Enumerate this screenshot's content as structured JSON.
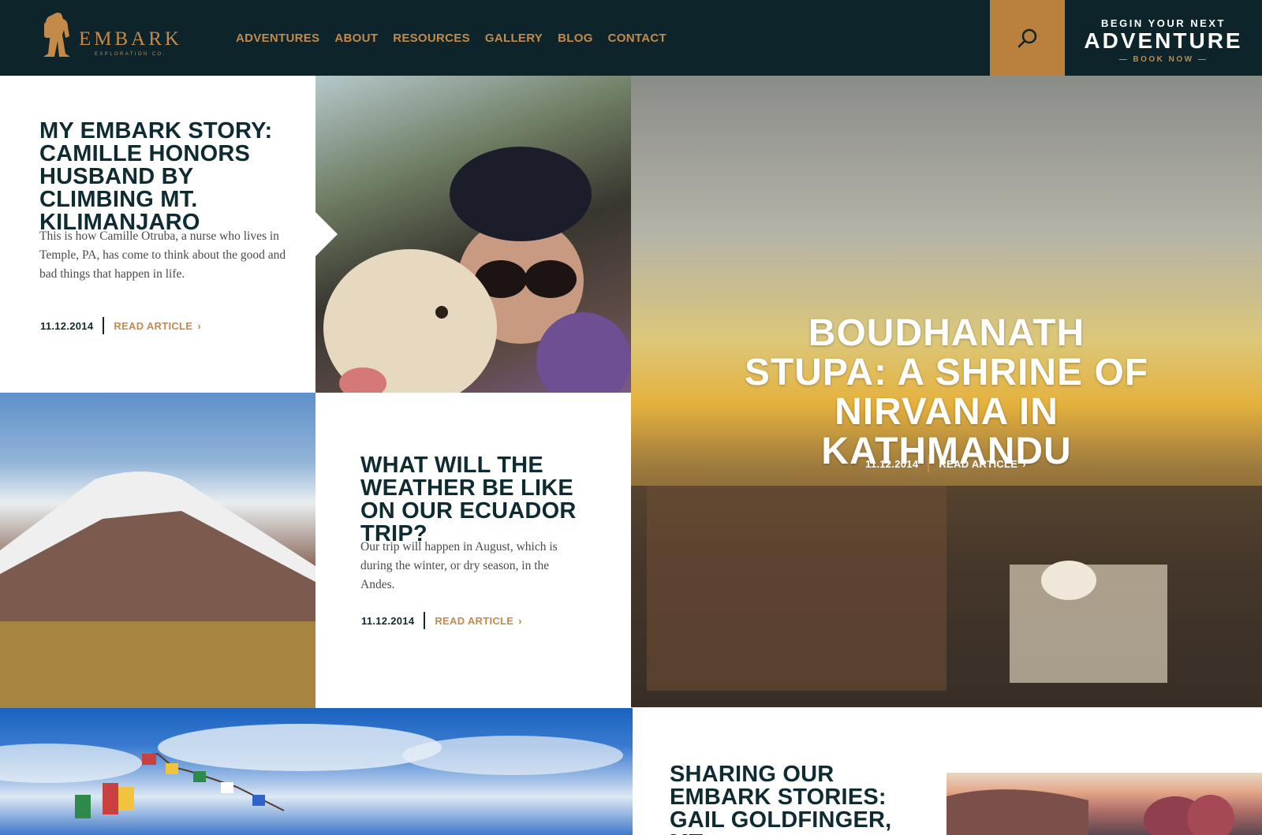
{
  "brand": {
    "logo_word": "EMBARK",
    "logo_sub": "EXPLORATION CO.",
    "color_primary": "#0c242a",
    "color_accent": "#c48a4a"
  },
  "nav": {
    "items": [
      "ADVENTURES",
      "ABOUT",
      "RESOURCES",
      "GALLERY",
      "BLOG",
      "CONTACT"
    ]
  },
  "search": {
    "icon": "search-icon"
  },
  "cta": {
    "top": "BEGIN YOUR NEXT",
    "main": "ADVENTURE",
    "book": "— BOOK NOW —"
  },
  "posts": [
    {
      "title": "MY EMBARK STORY: CAMILLE HONORS HUSBAND BY CLIMBING MT. KILIMANJARO",
      "excerpt": "This is how Camille Otruba, a nurse who lives in Temple, PA, has come to think about the good and bad things that happen in life.",
      "date": "11.12.2014",
      "link": "READ ARTICLE"
    },
    {
      "title": "WHAT WILL THE WEATHER BE LIKE ON OUR ECUADOR TRIP?",
      "excerpt": "Our trip will happen in August, which is during the winter, or dry season, in the Andes.",
      "date": "11.12.2014",
      "link": "READ ARTICLE"
    },
    {
      "title": "BOUDHANATH STUPA: A SHRINE OF NIRVANA IN KATHMANDU",
      "date": "11.12.2014",
      "link": "READ ARTICLE"
    },
    {
      "title": "SHARING OUR EMBARK STORIES: GAIL GOLDFINGER, MT."
    }
  ]
}
